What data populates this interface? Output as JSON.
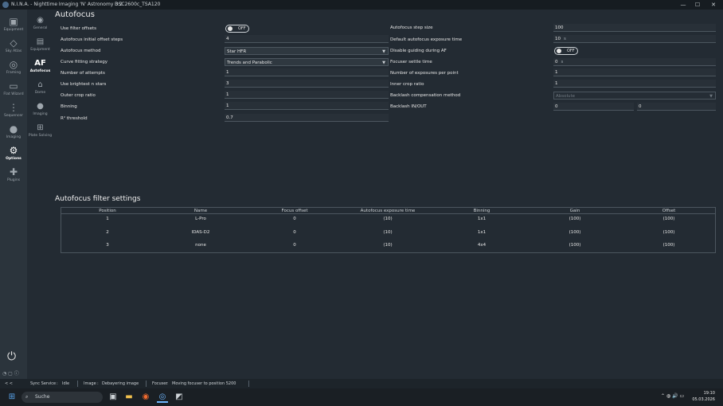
{
  "window": {
    "title": "N.I.N.A. - Nighttime Imaging 'N' Astronomy 3.2",
    "profile": "DSC2600c_TSA120",
    "min_glyph": "—",
    "max_glyph": "☐",
    "close_glyph": "✕"
  },
  "sidebar": {
    "items": [
      {
        "label": "Equipment",
        "icon": "camera-icon"
      },
      {
        "label": "Sky Atlas",
        "icon": "sky-atlas-icon"
      },
      {
        "label": "Framing",
        "icon": "framing-icon"
      },
      {
        "label": "Flat Wizard",
        "icon": "flat-wizard-icon"
      },
      {
        "label": "Sequencer",
        "icon": "sequencer-icon"
      },
      {
        "label": "Imaging",
        "icon": "imaging-icon"
      },
      {
        "label": "Options",
        "icon": "gears-icon"
      },
      {
        "label": "Plugins",
        "icon": "puzzle-icon"
      }
    ],
    "glyphs": [
      "▣",
      "◇",
      "◎",
      "▭",
      "⋮",
      "●",
      "⚙",
      "✚"
    ]
  },
  "subnav": {
    "items": [
      {
        "label": "General"
      },
      {
        "label": "Equipment"
      },
      {
        "label": "Autofocus"
      },
      {
        "label": "Dome"
      },
      {
        "label": "Imaging"
      },
      {
        "label": "Plate Solving"
      }
    ],
    "glyphs": [
      "◉",
      "▤",
      "AF",
      "⌂",
      "●",
      "⊞"
    ]
  },
  "power_glyph": "⏻",
  "bottom_glyphs": "◔ ▢ ⓘ",
  "autofocus": {
    "title": "Autofocus",
    "left": {
      "use_filter_offsets": {
        "label": "Use filter offsets",
        "value": "OFF"
      },
      "initial_offset_steps": {
        "label": "Autofocus initial offset steps",
        "value": "4"
      },
      "method": {
        "label": "Autofocus method",
        "value": "Star HFR"
      },
      "curve_fitting": {
        "label": "Curve fitting strategy",
        "value": "Trends and Parabolic"
      },
      "attempts": {
        "label": "Number of attempts",
        "value": "1"
      },
      "brightest_stars": {
        "label": "Use brightest n stars",
        "value": "3"
      },
      "outer_crop": {
        "label": "Outer crop ratio",
        "value": "1"
      },
      "binning": {
        "label": "Binning",
        "value": "1"
      },
      "r2_threshold": {
        "label": "R² threshold",
        "value": "0.7"
      }
    },
    "right": {
      "step_size": {
        "label": "Autofocus step size",
        "value": "100"
      },
      "exposure_time": {
        "label": "Default autofocus exposure time",
        "value": "10",
        "unit": "s"
      },
      "disable_guiding": {
        "label": "Disable guiding during AF",
        "value": "OFF"
      },
      "settle_time": {
        "label": "Focuser settle time",
        "value": "0",
        "unit": "s"
      },
      "exposures_per_point": {
        "label": "Number of exposures per point",
        "value": "1"
      },
      "inner_crop": {
        "label": "Inner crop ratio",
        "value": "1"
      },
      "backlash_method": {
        "label": "Backlash compensation method",
        "value": "Absolute"
      },
      "backlash_inout": {
        "label": "Backlash IN/OUT",
        "in": "0",
        "out": "0"
      }
    }
  },
  "filter_settings": {
    "title": "Autofocus filter settings",
    "columns": [
      "Position",
      "Name",
      "Focus offset",
      "Autofocus exposure time",
      "Binning",
      "Gain",
      "Offset"
    ],
    "rows": [
      [
        "1",
        "L-Pro",
        "0",
        "(10)",
        "1x1",
        "(100)",
        "(100)"
      ],
      [
        "2",
        "IDAS-D2",
        "0",
        "(10)",
        "1x1",
        "(100)",
        "(100)"
      ],
      [
        "3",
        "none",
        "0",
        "(10)",
        "4x4",
        "(100)",
        "(100)"
      ]
    ]
  },
  "statusbar": {
    "arrows": "< <",
    "sync": "Sync Service",
    "sync_status": "Idle",
    "image": "Image",
    "image_status": "Debayering image",
    "focuser": "Focuser",
    "focuser_status": "Moving focuser to position 5200",
    "colon": ":"
  },
  "taskbar": {
    "search_placeholder": "Suche",
    "time": "19:10",
    "date": "05.03.2026",
    "glyphs": {
      "start": "⊞",
      "search": "⌕",
      "task": "▣",
      "folder": "▬",
      "firefox": "◉",
      "nina": "◎",
      "other": "◩",
      "tray": "⌃ ◍ 🔊 ▭"
    }
  }
}
